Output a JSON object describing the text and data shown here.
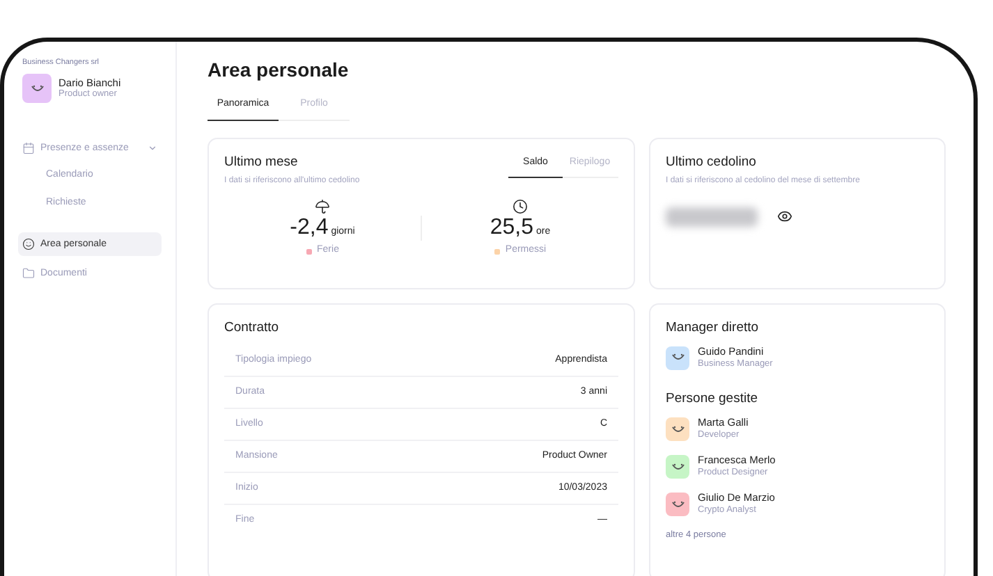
{
  "sidebar": {
    "company": "Business Changers srl",
    "user": {
      "name": "Dario Bianchi",
      "role": "Product owner",
      "color": "#e6c3f8"
    },
    "nav": [
      {
        "label": "Presenze e assenze",
        "kind": "calendar",
        "selected": false,
        "expanded": true,
        "children": [
          {
            "label": "Calendario",
            "selected": false
          },
          {
            "label": "Richieste",
            "selected": false
          }
        ]
      },
      {
        "label": "Area personale",
        "kind": "face",
        "selected": true
      },
      {
        "label": "Documenti",
        "kind": "folder",
        "selected": false
      }
    ]
  },
  "page": {
    "title": "Area personale",
    "tabs": [
      {
        "label": "Panoramica",
        "selected": true
      },
      {
        "label": "Profilo",
        "selected": false
      }
    ]
  },
  "last_month": {
    "title": "Ultimo mese",
    "subtitle": "I dati si riferiscono all'ultimo cedolino",
    "tabs": [
      {
        "label": "Saldo",
        "selected": true
      },
      {
        "label": "Riepilogo",
        "selected": false
      }
    ],
    "stats": [
      {
        "kind": "umbrella",
        "value": "-2,4",
        "unit": "giorni",
        "label": "Ferie",
        "color": "#f7a8b3"
      },
      {
        "kind": "clock",
        "value": "25,5",
        "unit": "ore",
        "label": "Permessi",
        "color": "#fcd3a8"
      }
    ]
  },
  "payslip": {
    "title": "Ultimo cedolino",
    "subtitle": "I dati si riferiscono al cedolino del mese di settembre"
  },
  "contract": {
    "title": "Contratto",
    "rows": [
      {
        "label": "Tipologia impiego",
        "value": "Apprendista"
      },
      {
        "label": "Durata",
        "value": "3 anni"
      },
      {
        "label": "Livello",
        "value": "C"
      },
      {
        "label": "Mansione",
        "value": "Product Owner"
      },
      {
        "label": "Inizio",
        "value": "10/03/2023"
      },
      {
        "label": "Fine",
        "value": "—"
      }
    ]
  },
  "manager": {
    "title": "Manager diretto",
    "person": {
      "name": "Guido Pandini",
      "role": "Business Manager",
      "color": "#c9e2fb"
    }
  },
  "managed": {
    "title": "Persone gestite",
    "people": [
      {
        "name": "Marta Galli",
        "role": "Developer",
        "color": "#fde0c0"
      },
      {
        "name": "Francesca Merlo",
        "role": "Product Designer",
        "color": "#c6f5c6"
      },
      {
        "name": "Giulio De Marzio",
        "role": "Crypto Analyst",
        "color": "#fbbcc2"
      }
    ],
    "more": "altre 4 persone"
  }
}
